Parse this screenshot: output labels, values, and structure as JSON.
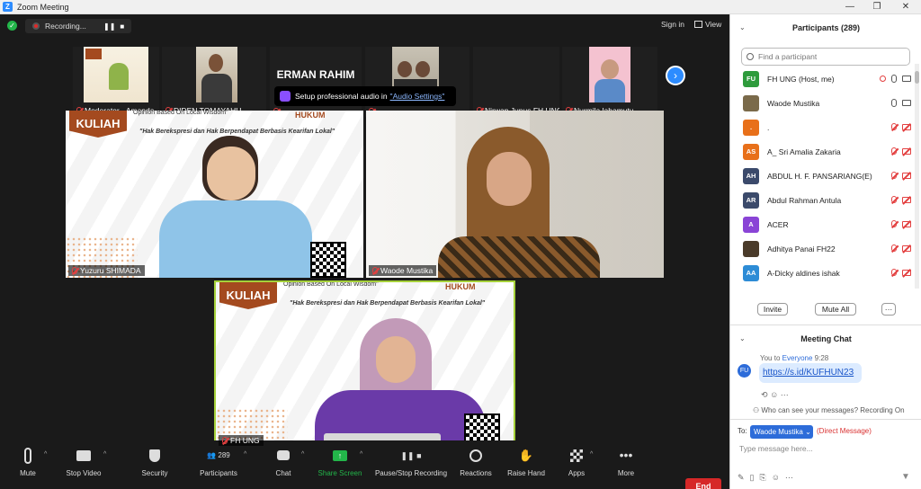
{
  "window": {
    "title": "Zoom Meeting",
    "min": "—",
    "restore": "❐",
    "close": "✕"
  },
  "topbar": {
    "recording_label": "Recording...",
    "pause": "❚❚",
    "stop": "■",
    "sign_in": "Sign in",
    "view": "View"
  },
  "thumbnails": [
    {
      "name": "Moderator - Amanda ...",
      "muted": true
    },
    {
      "name": "DIDEN TOMAYAHU",
      "muted": true
    },
    {
      "name": "ERMAN RAHIM",
      "muted": true
    },
    {
      "name": "",
      "muted": true
    },
    {
      "name": "Nirwan Junus FH UNG",
      "muted": true
    },
    {
      "name": "Nurmila lahamutu",
      "muted": true
    }
  ],
  "tooltip": {
    "text": "Setup professional audio in",
    "link": "\"Audio Settings\""
  },
  "tiles": {
    "tile1": {
      "name": "Yuzuru SHIMADA"
    },
    "tile2": {
      "name": "Waode Mustika"
    },
    "tile3": {
      "name": "FH UNG"
    }
  },
  "slide": {
    "badge": "KULIAH UMUM",
    "subtitle_1": "Opinion Based On Local Wisdom\"",
    "headline": "\"Hak Berekspresi dan Hak Berpendapat Berbasis Kearifan Lokal\"",
    "logo": "HUKUM"
  },
  "toolbar": {
    "mute": "Mute",
    "stop_video": "Stop Video",
    "security": "Security",
    "participants": "Participants",
    "participants_count": "289",
    "chat": "Chat",
    "share_screen": "Share Screen",
    "pause_recording": "Pause/Stop Recording",
    "reactions": "Reactions",
    "raise_hand": "Raise Hand",
    "apps": "Apps",
    "more": "More",
    "end": "End"
  },
  "participants_panel": {
    "header": "Participants (289)",
    "search_placeholder": "Find a participant",
    "items": [
      {
        "initials": "FU",
        "color": "#2e9b3c",
        "name": "FH UNG (Host, me)"
      },
      {
        "initials": "",
        "color": "#7a6a4a",
        "name": "Waode Mustika"
      },
      {
        "initials": ".",
        "color": "#e8701a",
        "name": "."
      },
      {
        "initials": "AS",
        "color": "#e8701a",
        "name": "A_ Sri Amalia Zakaria"
      },
      {
        "initials": "AH",
        "color": "#3b4a6b",
        "name": "ABDUL H. F. PANSARIANG(E)"
      },
      {
        "initials": "AR",
        "color": "#3b4a6b",
        "name": "Abdul Rahman Antula"
      },
      {
        "initials": "A",
        "color": "#8a44d6",
        "name": "ACER"
      },
      {
        "initials": "",
        "color": "#4a3b2a",
        "name": "Adhitya Panai FH22"
      },
      {
        "initials": "AA",
        "color": "#2d8cd6",
        "name": "A-Dicky aldines ishak"
      }
    ],
    "invite": "Invite",
    "mute_all": "Mute All",
    "more": "···"
  },
  "chat_panel": {
    "header": "Meeting Chat",
    "from": "You to",
    "to": "Everyone",
    "time": "9:28",
    "avatar": "FU",
    "message": "https://s.id/KUFHUN23",
    "who_can_see": "Who can see your messages? Recording On",
    "to_label": "To:",
    "recipient": "Waode Mustika",
    "direct": "(Direct Message)",
    "placeholder": "Type message here..."
  },
  "colors": {
    "accent": "#2d8cff",
    "end": "#d62828",
    "share": "#23b64a"
  }
}
